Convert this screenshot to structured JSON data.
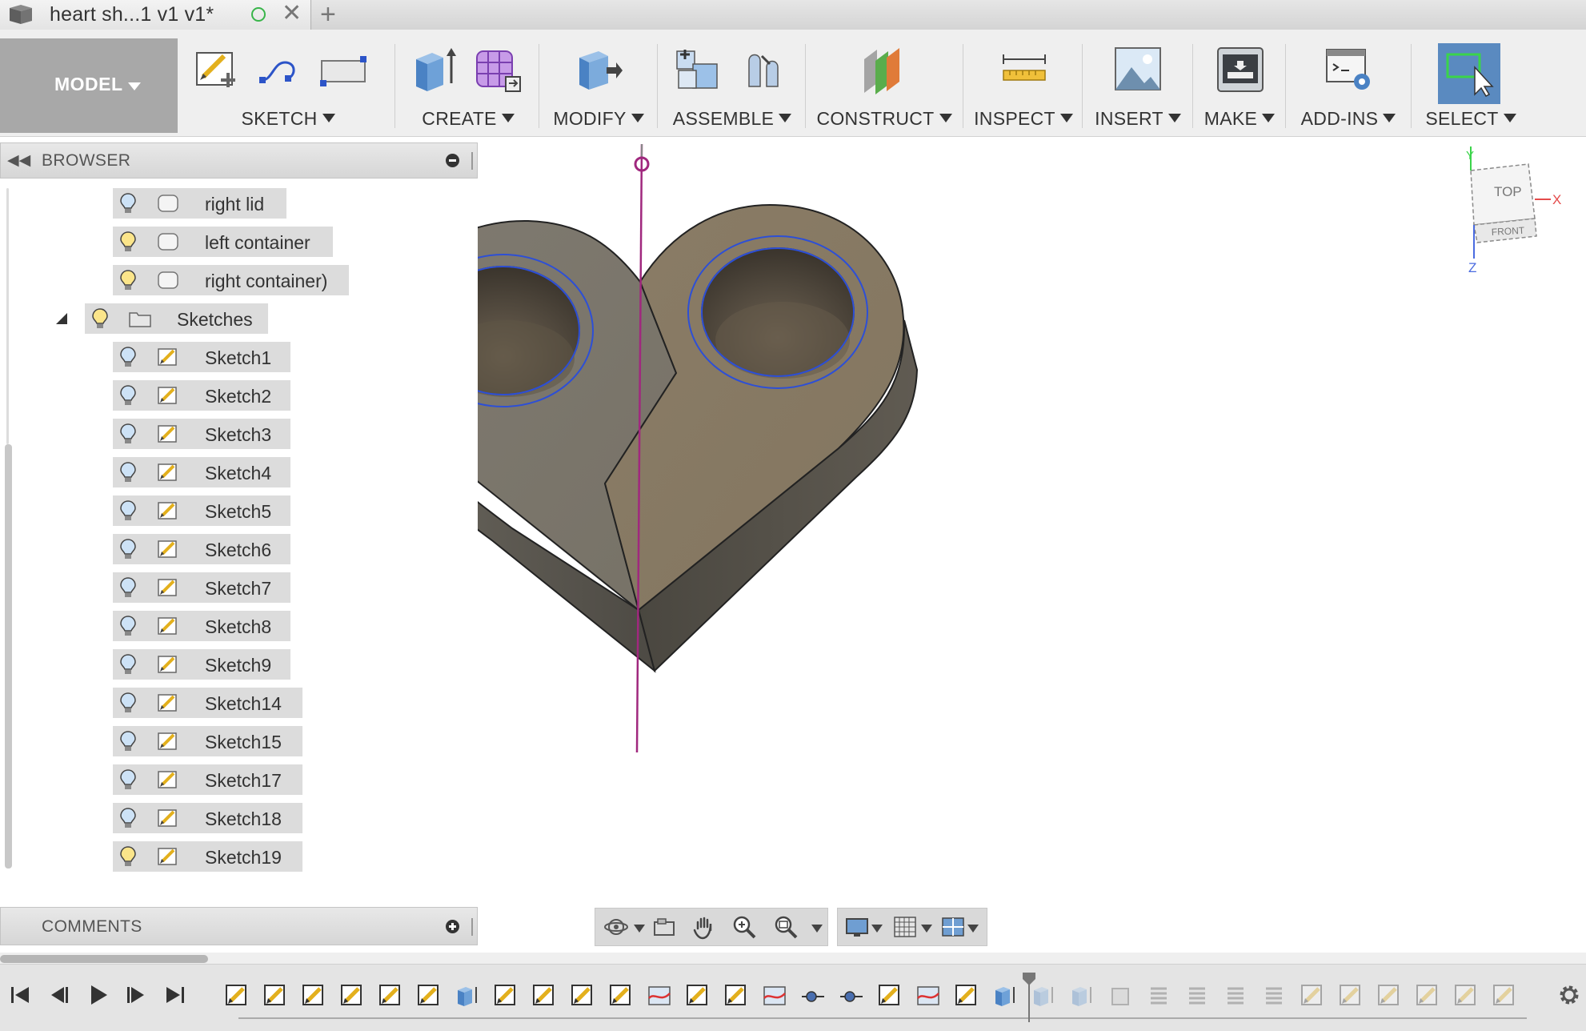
{
  "tab": {
    "title": "heart sh...1 v1 v1*",
    "new_tab_symbol": "+",
    "close_symbol": "✕",
    "save_state_color": "#39b54a"
  },
  "toolbar": {
    "workspace": "MODEL",
    "groups": {
      "sketch": "SKETCH",
      "create": "CREATE",
      "modify": "MODIFY",
      "assemble": "ASSEMBLE",
      "construct": "CONSTRUCT",
      "inspect": "INSPECT",
      "insert": "INSERT",
      "make": "MAKE",
      "addins": "ADD-INS",
      "select": "SELECT"
    },
    "active_color": "#5a8ac0"
  },
  "browser": {
    "title": "BROWSER",
    "items": [
      {
        "label": "right lid",
        "bulb": "off"
      },
      {
        "label": "left container",
        "bulb": "on"
      },
      {
        "label": "right container)",
        "bulb": "on"
      }
    ],
    "sketches_folder": "Sketches",
    "sketches": [
      {
        "label": "Sketch1",
        "bulb": "off"
      },
      {
        "label": "Sketch2",
        "bulb": "off"
      },
      {
        "label": "Sketch3",
        "bulb": "off"
      },
      {
        "label": "Sketch4",
        "bulb": "off"
      },
      {
        "label": "Sketch5",
        "bulb": "off"
      },
      {
        "label": "Sketch6",
        "bulb": "off"
      },
      {
        "label": "Sketch7",
        "bulb": "off"
      },
      {
        "label": "Sketch8",
        "bulb": "off"
      },
      {
        "label": "Sketch9",
        "bulb": "off"
      },
      {
        "label": "Sketch14",
        "bulb": "off"
      },
      {
        "label": "Sketch15",
        "bulb": "off"
      },
      {
        "label": "Sketch17",
        "bulb": "off"
      },
      {
        "label": "Sketch18",
        "bulb": "off"
      },
      {
        "label": "Sketch19",
        "bulb": "on"
      }
    ]
  },
  "comments": {
    "title": "COMMENTS"
  },
  "viewcube": {
    "top": "TOP",
    "front": "FRONT",
    "axis_x": "X",
    "axis_y": "Y",
    "axis_z": "Z"
  },
  "model": {
    "body_color": "#7e776c",
    "sketch_line_color": "#2d4fd6",
    "axis_color": "#a0287e"
  }
}
